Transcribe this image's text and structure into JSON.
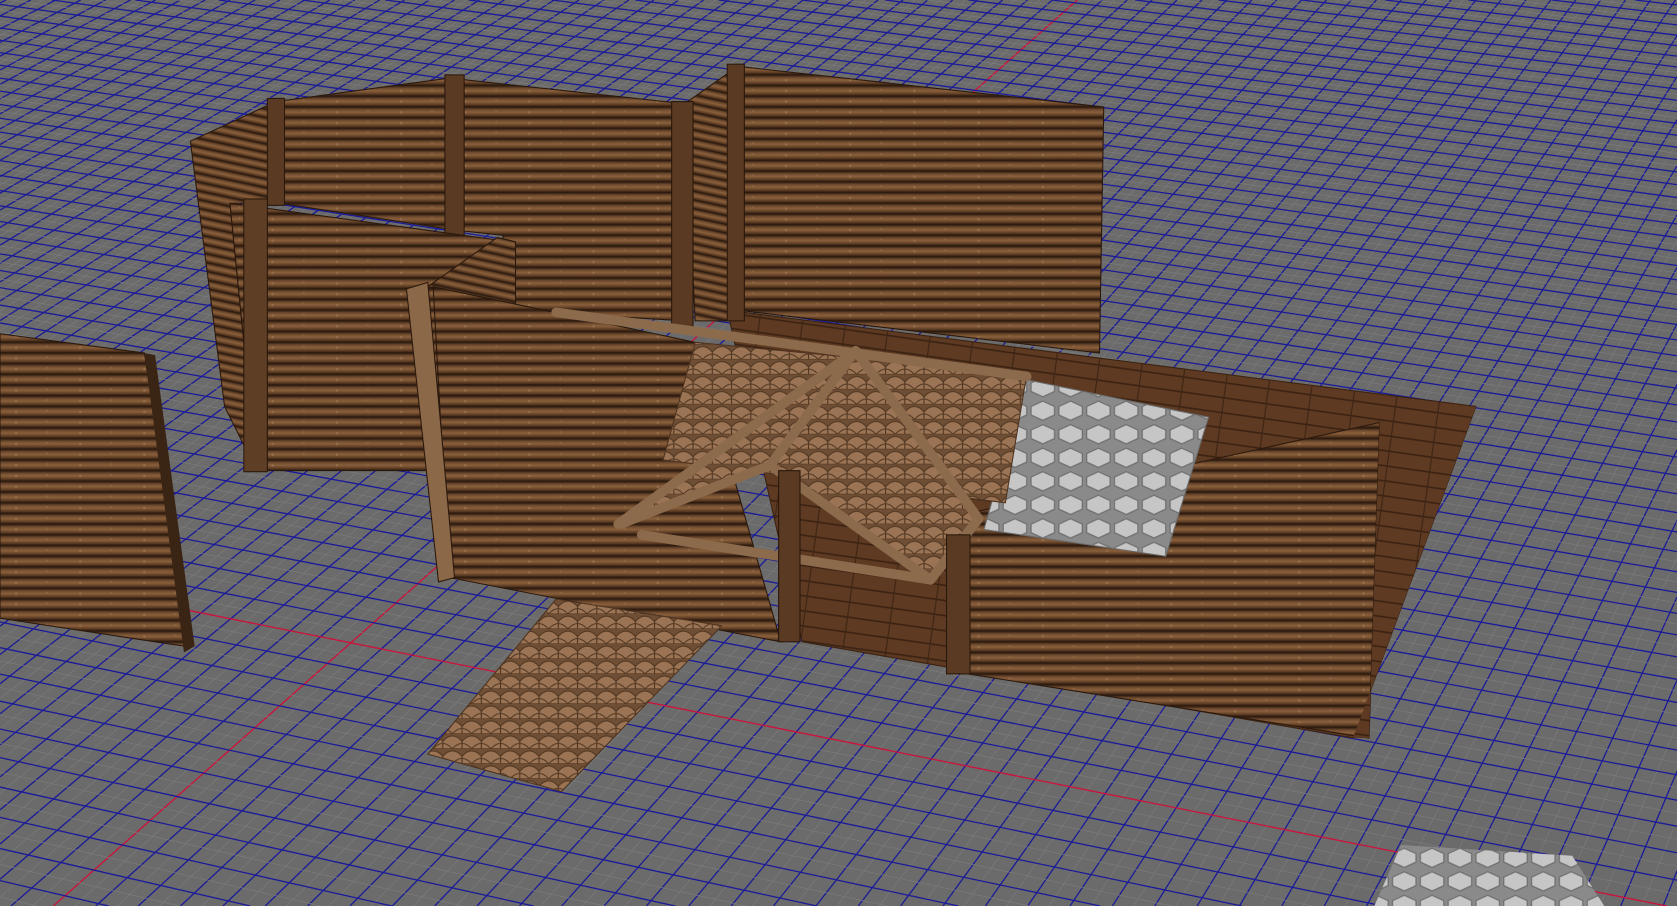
{
  "viewport": {
    "colors": {
      "background": "#6b6b6b",
      "checker": "#626262",
      "grid_major": "#1a1a9a",
      "grid_minor": "#7c7c7c",
      "axis_red": "#d0103a",
      "wood_dark": "#3a2414",
      "wood_light": "#7a5434",
      "floor": "#5e3a22",
      "roof_tile": "#8a6646",
      "hex_panel": "#b8b8b8"
    }
  }
}
